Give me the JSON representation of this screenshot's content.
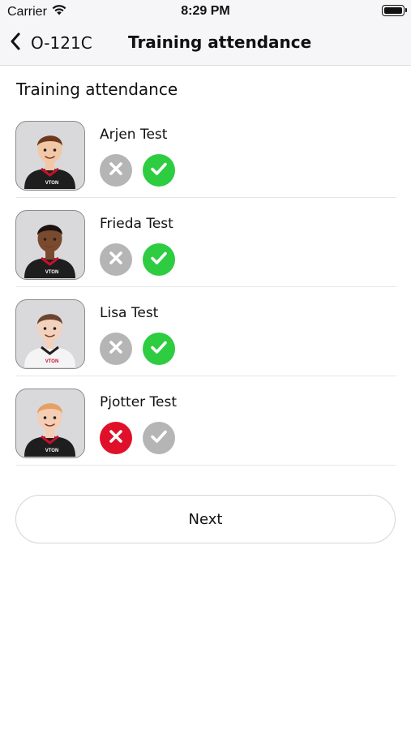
{
  "status_bar": {
    "carrier": "Carrier",
    "time": "8:29 PM"
  },
  "nav": {
    "back_label": "O-121C",
    "title": "Training attendance"
  },
  "section_title": "Training attendance",
  "colors": {
    "present_active": "#2ecc40",
    "absent_active": "#e0102a",
    "inactive": "#b5b5b5"
  },
  "players": [
    {
      "name": "Arjen Test",
      "absent_selected": false,
      "present_selected": true,
      "shirt": "dark"
    },
    {
      "name": "Frieda Test",
      "absent_selected": false,
      "present_selected": true,
      "shirt": "dark"
    },
    {
      "name": "Lisa Test",
      "absent_selected": false,
      "present_selected": true,
      "shirt": "light"
    },
    {
      "name": "Pjotter Test",
      "absent_selected": true,
      "present_selected": false,
      "shirt": "dark"
    }
  ],
  "avatar_logo_text": "VTON",
  "next_label": "Next"
}
